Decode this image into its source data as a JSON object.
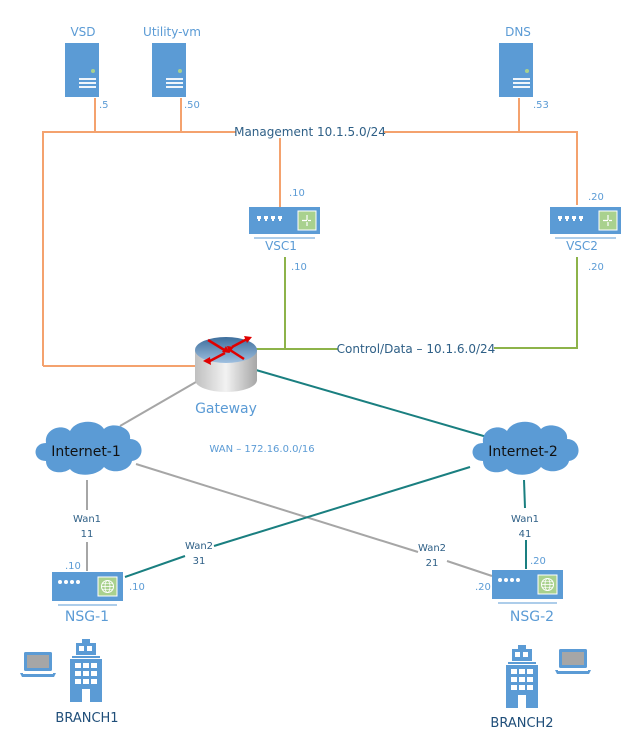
{
  "colors": {
    "management": "#f4a26e",
    "control_data": "#8db34a",
    "wan_primary": "#1a7f80",
    "wan_secondary": "#a6a6a6",
    "device_blue": "#5b9bd5",
    "device_green": "#a9d18e",
    "label_dark": "#2e5f86"
  },
  "servers": [
    {
      "name": "VSD",
      "ip": ".5"
    },
    {
      "name": "Utility-vm",
      "ip": ".50"
    },
    {
      "name": "DNS",
      "ip": ".53"
    }
  ],
  "networks": {
    "management": "Management 10.1.5.0/24",
    "control_data": "Control/Data – 10.1.6.0/24",
    "wan": "WAN – 172.16.0.0/16"
  },
  "vscs": [
    {
      "name": "VSC1",
      "mgmt_ip": ".10",
      "ctrl_ip": ".10"
    },
    {
      "name": "VSC2",
      "mgmt_ip": ".20",
      "ctrl_ip": ".20"
    }
  ],
  "gateway": {
    "name": "Gateway"
  },
  "clouds": [
    {
      "name": "Internet-1"
    },
    {
      "name": "Internet-2"
    }
  ],
  "nsgs": [
    {
      "name": "NSG-1",
      "wan1": {
        "label": "Wan1",
        "num": "11",
        "ip": ".10"
      },
      "wan2": {
        "label": "Wan2",
        "num": "31",
        "ip": ".10"
      }
    },
    {
      "name": "NSG-2",
      "wan1": {
        "label": "Wan1",
        "num": "41",
        "ip": ".20"
      },
      "wan2": {
        "label": "Wan2",
        "num": "21",
        "ip": ".20"
      }
    }
  ],
  "branches": [
    {
      "name": "BRANCH1"
    },
    {
      "name": "BRANCH2"
    }
  ]
}
